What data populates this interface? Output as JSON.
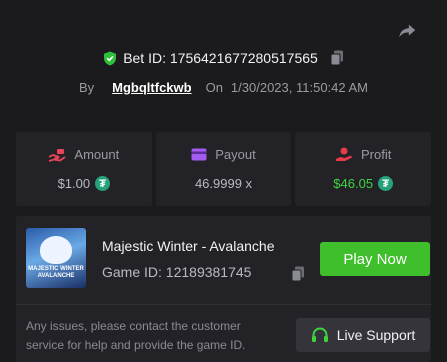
{
  "bet": {
    "id_label": "Bet ID: 1756421677280517565",
    "by_label": "By",
    "username": "Mgbqltfckwb",
    "on_label": "On",
    "datetime": "1/30/2023, 11:50:42 AM"
  },
  "stats": {
    "amount": {
      "label": "Amount",
      "value": "$1.00"
    },
    "payout": {
      "label": "Payout",
      "value": "46.9999 x"
    },
    "profit": {
      "label": "Profit",
      "value": "$46.05"
    }
  },
  "game": {
    "title": "Majestic Winter - Avalanche",
    "id_label": "Game ID: 12189381745",
    "thumb_text_1": "MAJESTIC WINTER",
    "thumb_text_2": "AVALANCHE",
    "play_label": "Play Now"
  },
  "support": {
    "message": "Any issues, please contact the customer service for help and provide the game ID.",
    "button_label": "Live Support"
  },
  "colors": {
    "background": "#1b1b1d",
    "card": "#232327",
    "play_green": "#3fbf2b",
    "profit_green": "#3fd43f",
    "tether": "#26a17b",
    "amount_icon": "#e8455b",
    "payout_icon": "#a35cf0",
    "profit_icon": "#e83b4a"
  },
  "icons": {
    "share": "share-arrow-icon",
    "verified": "verified-shield-icon",
    "copy": "copy-icon",
    "amount": "hand-coin-icon",
    "payout": "wallet-icon",
    "profit": "profit-hand-icon",
    "currency": "tether-icon",
    "support": "headset-icon"
  }
}
